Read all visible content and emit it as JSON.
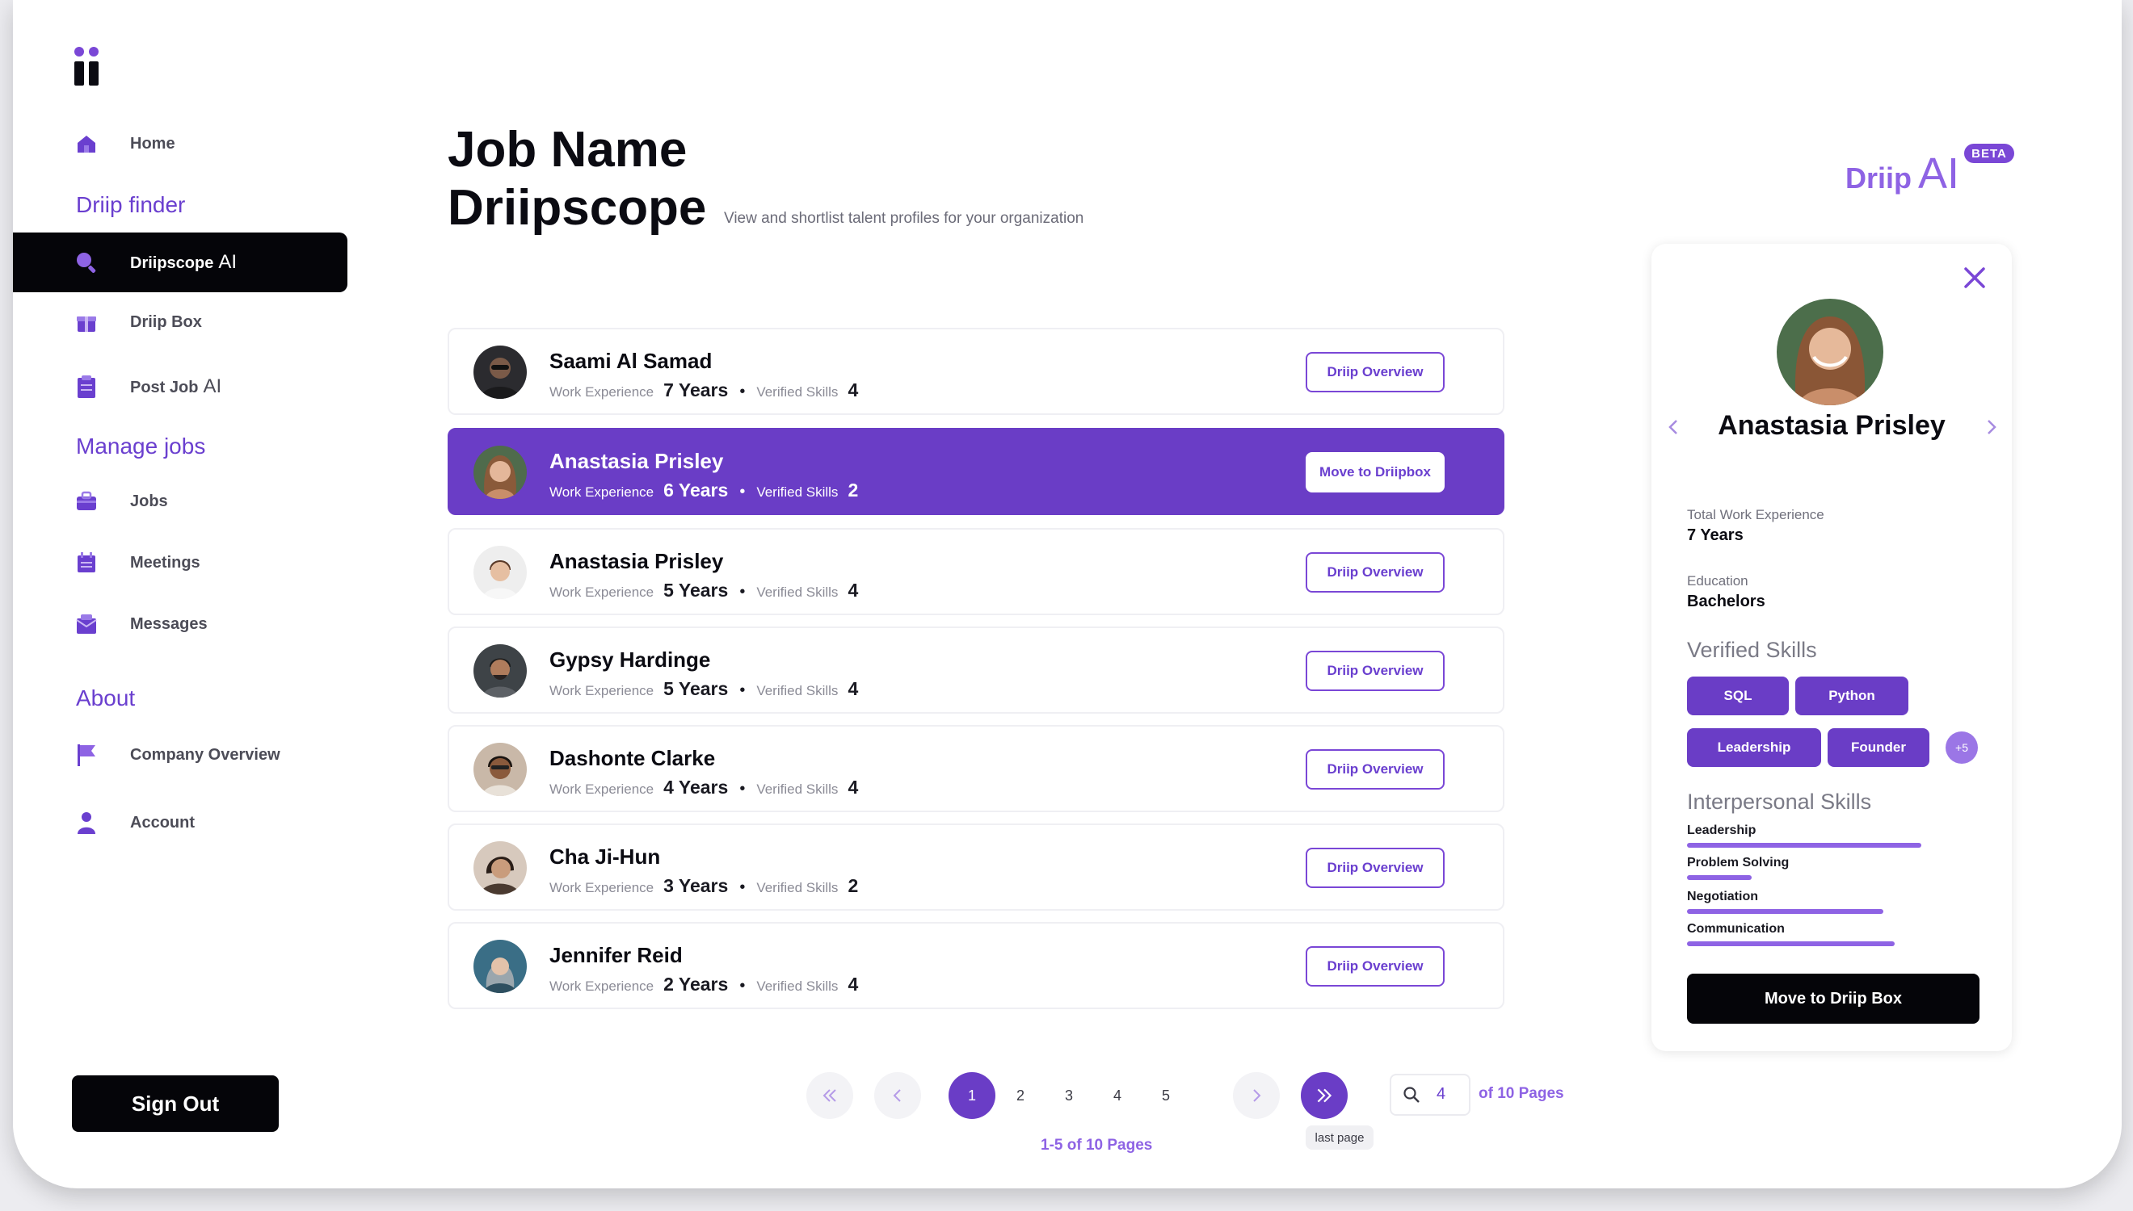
{
  "sidebar": {
    "home": "Home",
    "section_driip_finder": "Driip finder",
    "driipscope": "Driipscope",
    "driipscope_ai": "AI",
    "driip_box": "Driip Box",
    "post_job": "Post Job",
    "post_job_ai": "AI",
    "section_manage_jobs": "Manage jobs",
    "jobs": "Jobs",
    "meetings": "Meetings",
    "messages": "Messages",
    "section_about": "About",
    "company_overview": "Company Overview",
    "account": "Account",
    "sign_out": "Sign Out"
  },
  "header": {
    "title_line1": "Job Name",
    "title_line2": "Driipscope",
    "subtitle": "View and shortlist talent profiles for your organization",
    "brand_driip": "Driip",
    "brand_ai": "AI",
    "beta": "BETA"
  },
  "list": {
    "work_experience_label": "Work Experience",
    "verified_skills_label": "Verified Skills",
    "candidates": [
      {
        "name": "Saami Al Samad",
        "years": "7 Years",
        "skills": "4",
        "action": "Driip Overview"
      },
      {
        "name": "Anastasia Prisley",
        "years": "6 Years",
        "skills": "2",
        "action": "Move to Driipbox"
      },
      {
        "name": "Anastasia Prisley",
        "years": "5 Years",
        "skills": "4",
        "action": "Driip Overview"
      },
      {
        "name": "Gypsy Hardinge",
        "years": "5 Years",
        "skills": "4",
        "action": "Driip Overview"
      },
      {
        "name": "Dashonte Clarke",
        "years": "4 Years",
        "skills": "4",
        "action": "Driip Overview"
      },
      {
        "name": "Cha Ji-Hun",
        "years": "3 Years",
        "skills": "2",
        "action": "Driip Overview"
      },
      {
        "name": "Jennifer Reid",
        "years": "2 Years",
        "skills": "4",
        "action": "Driip Overview"
      }
    ]
  },
  "pagination": {
    "pages": [
      "1",
      "2",
      "3",
      "4",
      "5"
    ],
    "current": "1",
    "search_value": "4",
    "of_pages": "of 10 Pages",
    "last_page_tooltip": "last page",
    "range": "1-5 of 10 Pages"
  },
  "detail": {
    "name": "Anastasia Prisley",
    "total_exp_label": "Total Work Experience",
    "total_exp_value": "7 Years",
    "education_label": "Education",
    "education_value": "Bachelors",
    "verified_skills_title": "Verified Skills",
    "verified_skills": [
      "SQL",
      "Python",
      "Leadership",
      "Founder"
    ],
    "more_skills": "+5",
    "interpersonal_title": "Interpersonal Skills",
    "interpersonal": [
      {
        "label": "Leadership",
        "level": 0.8
      },
      {
        "label": "Problem Solving",
        "level": 0.22
      },
      {
        "label": "Negotiation",
        "level": 0.67
      },
      {
        "label": "Communication",
        "level": 0.71
      }
    ],
    "move_button": "Move to Driip Box"
  },
  "colors": {
    "accent": "#6a3dc6",
    "accent_light": "#8e63e4",
    "dark": "#050509"
  }
}
